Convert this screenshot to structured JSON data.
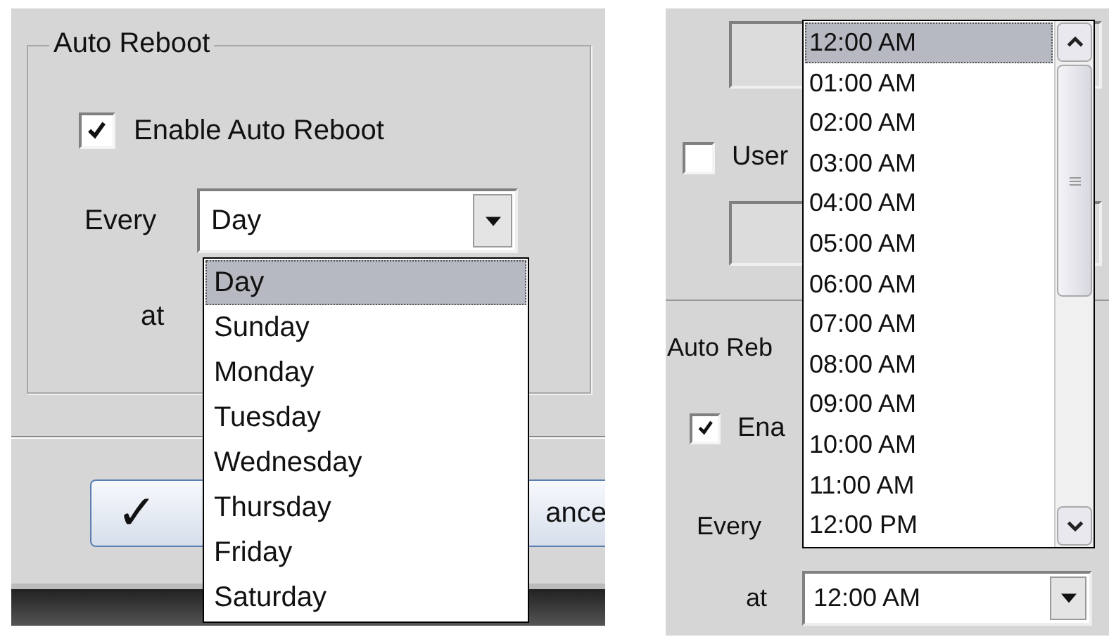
{
  "left_dialog": {
    "group_title": "Auto Reboot",
    "enable_checkbox": {
      "label": "Enable Auto Reboot",
      "checked": true
    },
    "every_label": "Every",
    "every_combo": {
      "value": "Day"
    },
    "day_dropdown": [
      {
        "label": "Day",
        "selected": true
      },
      {
        "label": "Sunday",
        "selected": false
      },
      {
        "label": "Monday",
        "selected": false
      },
      {
        "label": "Tuesday",
        "selected": false
      },
      {
        "label": "Wednesday",
        "selected": false
      },
      {
        "label": "Thursday",
        "selected": false
      },
      {
        "label": "Friday",
        "selected": false
      },
      {
        "label": "Saturday",
        "selected": false
      }
    ],
    "at_label": "at",
    "ok_button": {
      "icon": "✓"
    },
    "cancel_button": {
      "label": "ance"
    }
  },
  "right_dialog": {
    "user_checkbox": {
      "label": "User",
      "checked": false
    },
    "group_title": "Auto Reb",
    "enable_checkbox": {
      "label": "Ena",
      "checked": true
    },
    "every_label": "Every",
    "at_label": "at",
    "at_combo": {
      "value": "12:00 AM"
    },
    "time_dropdown": [
      {
        "label": "12:00 AM",
        "selected": true
      },
      {
        "label": "01:00 AM",
        "selected": false
      },
      {
        "label": "02:00 AM",
        "selected": false
      },
      {
        "label": "03:00 AM",
        "selected": false
      },
      {
        "label": "04:00 AM",
        "selected": false
      },
      {
        "label": "05:00 AM",
        "selected": false
      },
      {
        "label": "06:00 AM",
        "selected": false
      },
      {
        "label": "07:00 AM",
        "selected": false
      },
      {
        "label": "08:00 AM",
        "selected": false
      },
      {
        "label": "09:00 AM",
        "selected": false
      },
      {
        "label": "10:00 AM",
        "selected": false
      },
      {
        "label": "11:00 AM",
        "selected": false
      },
      {
        "label": "12:00 PM",
        "selected": false
      }
    ]
  }
}
